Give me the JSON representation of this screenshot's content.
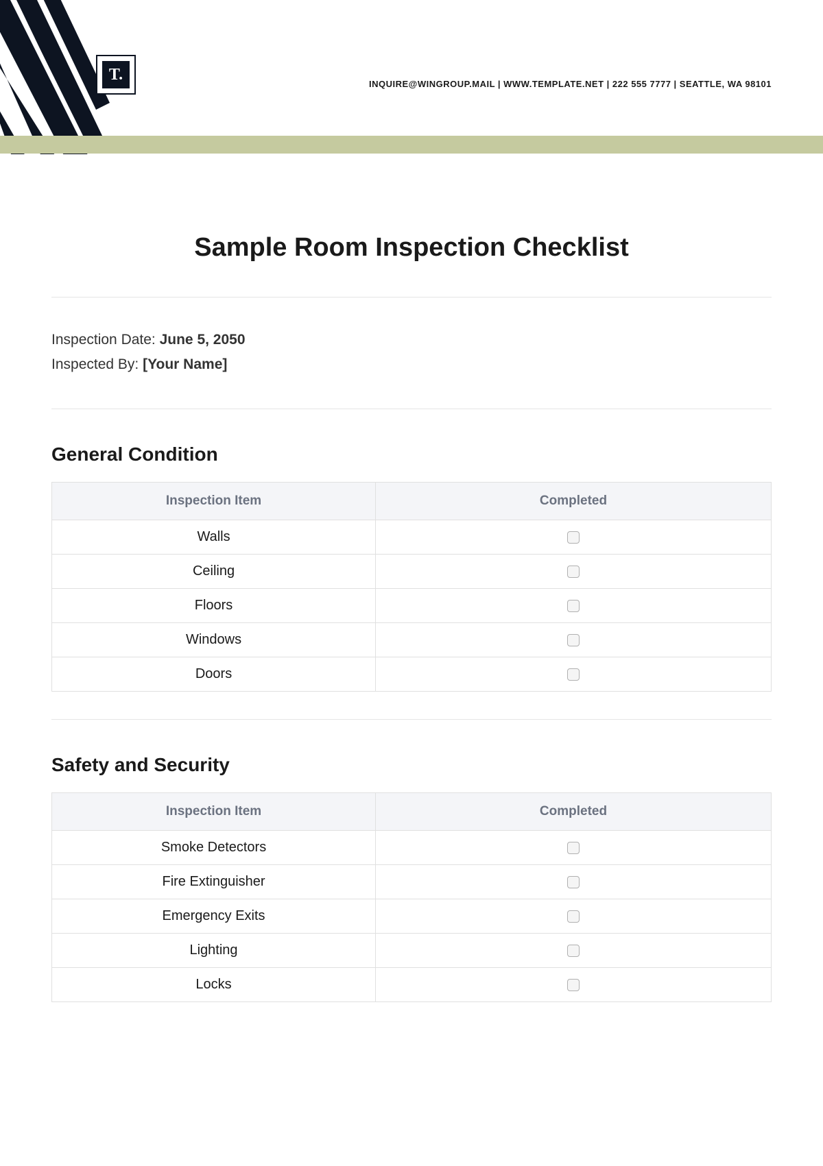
{
  "header": {
    "logo_text": "T.",
    "contact": "INQUIRE@WINGROUP.MAIL | WWW.TEMPLATE.NET | 222 555 7777 | SEATTLE, WA 98101"
  },
  "title": "Sample Room Inspection Checklist",
  "meta": {
    "date_label": "Inspection Date: ",
    "date_value": "June 5, 2050",
    "by_label": "Inspected By: ",
    "by_value": "[Your Name]"
  },
  "table_headers": {
    "item": "Inspection Item",
    "completed": "Completed"
  },
  "sections": [
    {
      "heading": "General Condition",
      "items": [
        "Walls",
        "Ceiling",
        "Floors",
        "Windows",
        "Doors"
      ]
    },
    {
      "heading": "Safety and Security",
      "items": [
        "Smoke Detectors",
        "Fire Extinguisher",
        "Emergency Exits",
        "Lighting",
        "Locks"
      ]
    }
  ]
}
